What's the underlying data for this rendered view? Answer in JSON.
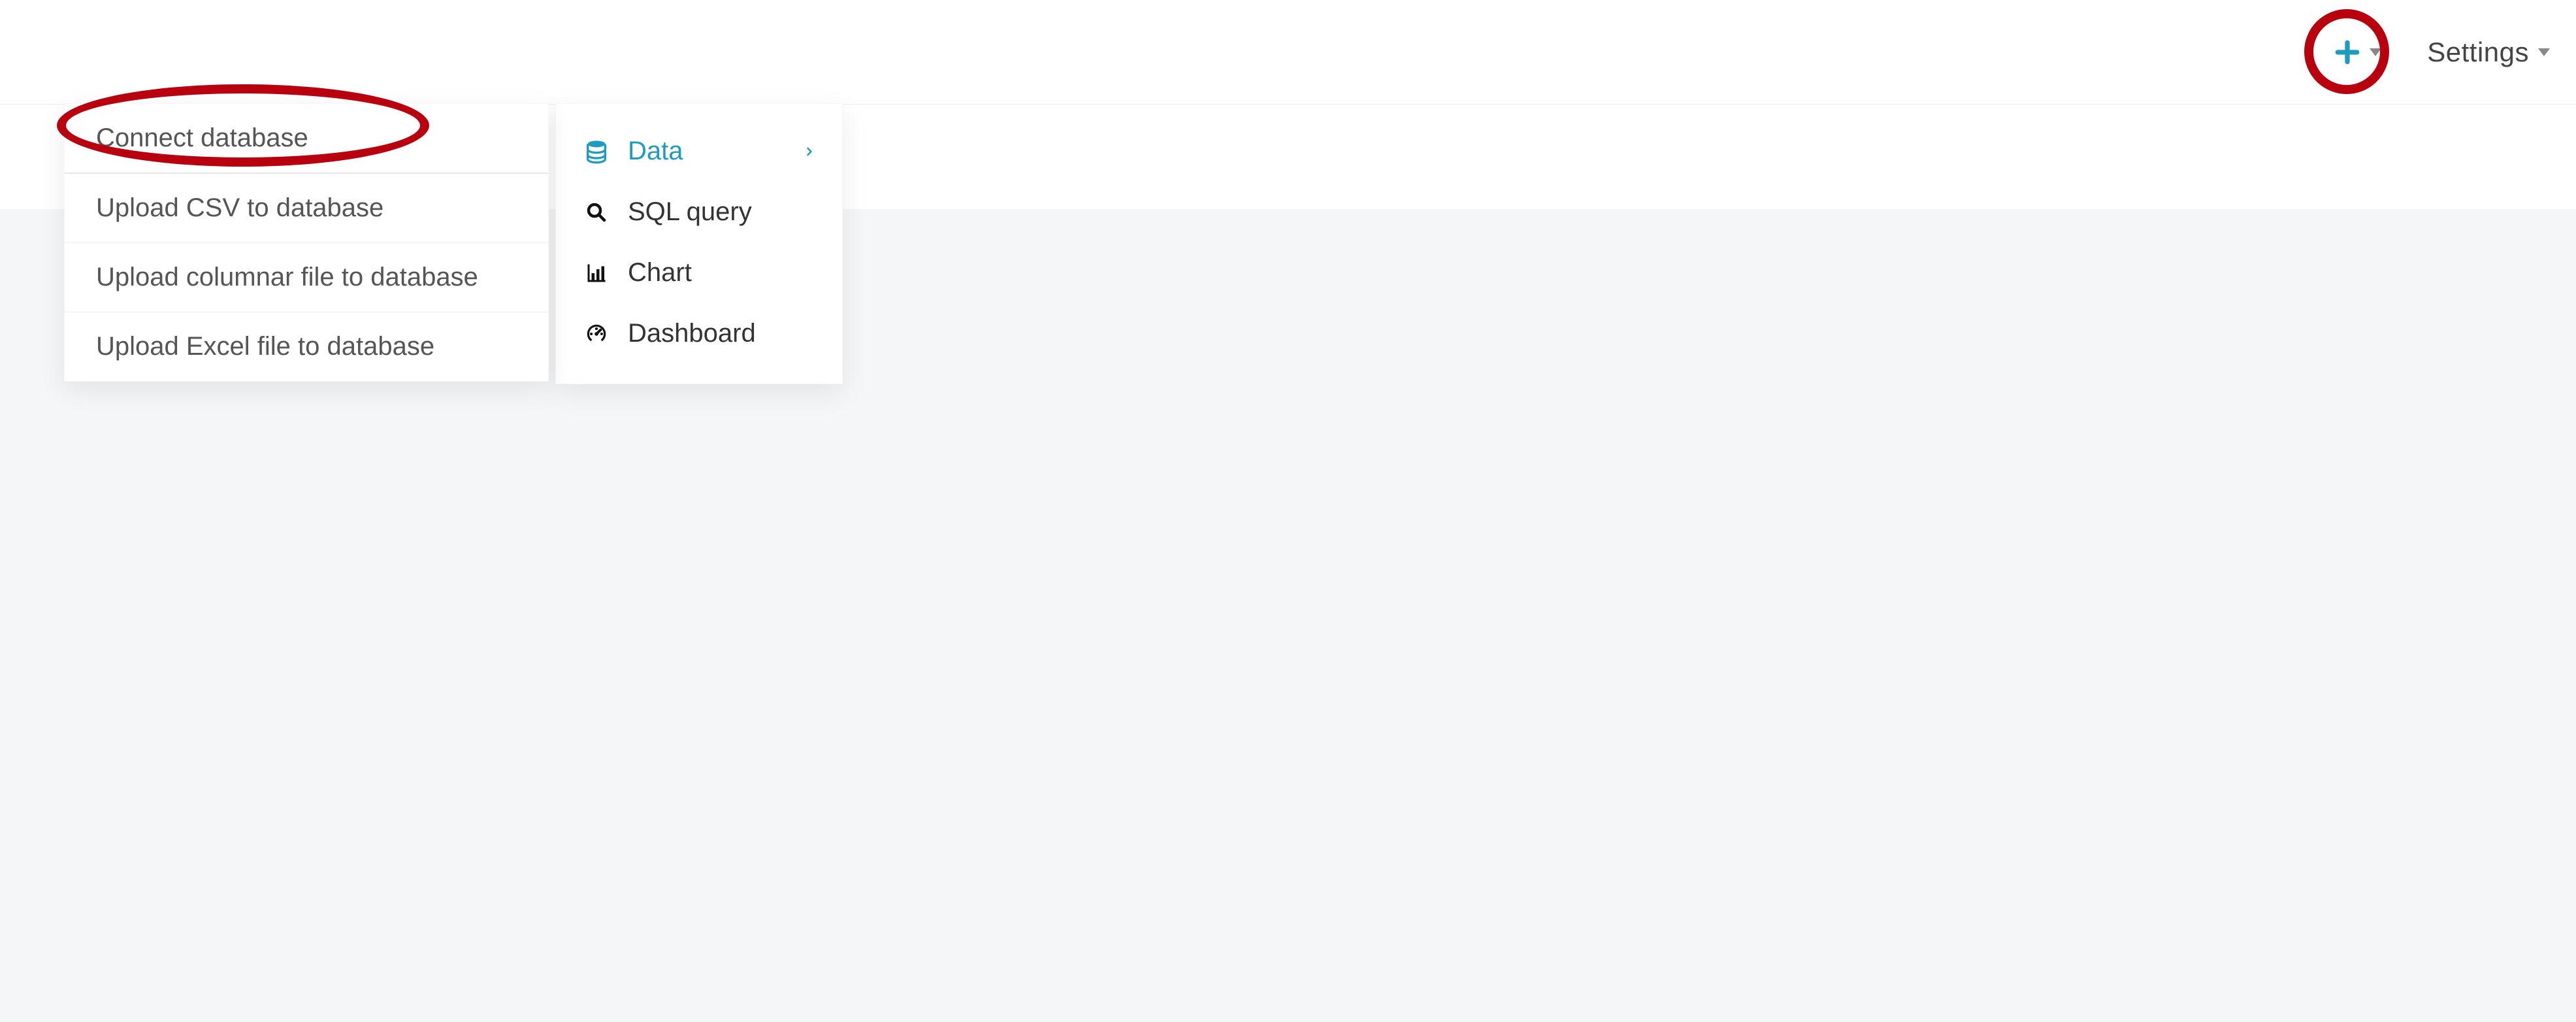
{
  "topbar": {
    "settings_label": "Settings"
  },
  "menu": {
    "data": {
      "label": "Data"
    },
    "sql": {
      "label": "SQL query"
    },
    "chart": {
      "label": "Chart"
    },
    "dashboard": {
      "label": "Dashboard"
    }
  },
  "submenu": {
    "connect": {
      "label": "Connect database"
    },
    "csv": {
      "label": "Upload CSV to database"
    },
    "columnar": {
      "label": "Upload columnar file to database"
    },
    "excel": {
      "label": "Upload Excel file to database"
    }
  },
  "colors": {
    "accent": "#1f9bbf",
    "annotation": "#b8000f"
  }
}
